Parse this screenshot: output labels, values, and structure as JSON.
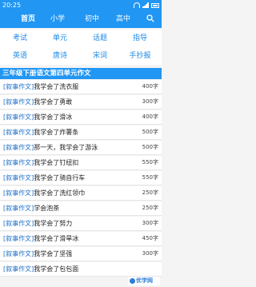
{
  "status": {
    "time": "20:25"
  },
  "nav": {
    "tabs": [
      {
        "label": "首页"
      },
      {
        "label": "小学"
      },
      {
        "label": "初中"
      },
      {
        "label": "高中"
      }
    ]
  },
  "categories": [
    {
      "label": "考试"
    },
    {
      "label": "单元"
    },
    {
      "label": "话题"
    },
    {
      "label": "指导"
    },
    {
      "label": "英语"
    },
    {
      "label": "唐诗"
    },
    {
      "label": "宋词"
    },
    {
      "label": "手抄报"
    }
  ],
  "section": {
    "title": "三年级下册语文第四单元作文"
  },
  "articles": [
    {
      "tag": "[叙事作文]",
      "title": "我学会了洗衣服",
      "count": "400字"
    },
    {
      "tag": "[叙事作文]",
      "title": "我学会了勇敢",
      "count": "300字"
    },
    {
      "tag": "[叙事作文]",
      "title": "我学会了滑冰",
      "count": "400字"
    },
    {
      "tag": "[叙事作文]",
      "title": "我学会了炸薯条",
      "count": "500字"
    },
    {
      "tag": "[叙事作文]",
      "title": "那一天，我学会了游泳",
      "count": "500字"
    },
    {
      "tag": "[叙事作文]",
      "title": "我学会了钉纽扣",
      "count": "550字"
    },
    {
      "tag": "[叙事作文]",
      "title": "我学会了骑自行车",
      "count": "550字"
    },
    {
      "tag": "[叙事作文]",
      "title": "我学会了洗红领巾",
      "count": "250字"
    },
    {
      "tag": "[叙事作文]",
      "title": "学会泡茶",
      "count": "250字"
    },
    {
      "tag": "[叙事作文]",
      "title": "我学会了努力",
      "count": "300字"
    },
    {
      "tag": "[叙事作文]",
      "title": "我学会了滑旱冰",
      "count": "450字"
    },
    {
      "tag": "[叙事作文]",
      "title": "我学会了坚强",
      "count": "300字"
    },
    {
      "tag": "[叙事作文]",
      "title": "我学会了包包面",
      "count": ""
    }
  ],
  "brand": {
    "text": "优学网"
  },
  "colors": {
    "primary": "#2196f3",
    "link": "#1e6fc8"
  }
}
